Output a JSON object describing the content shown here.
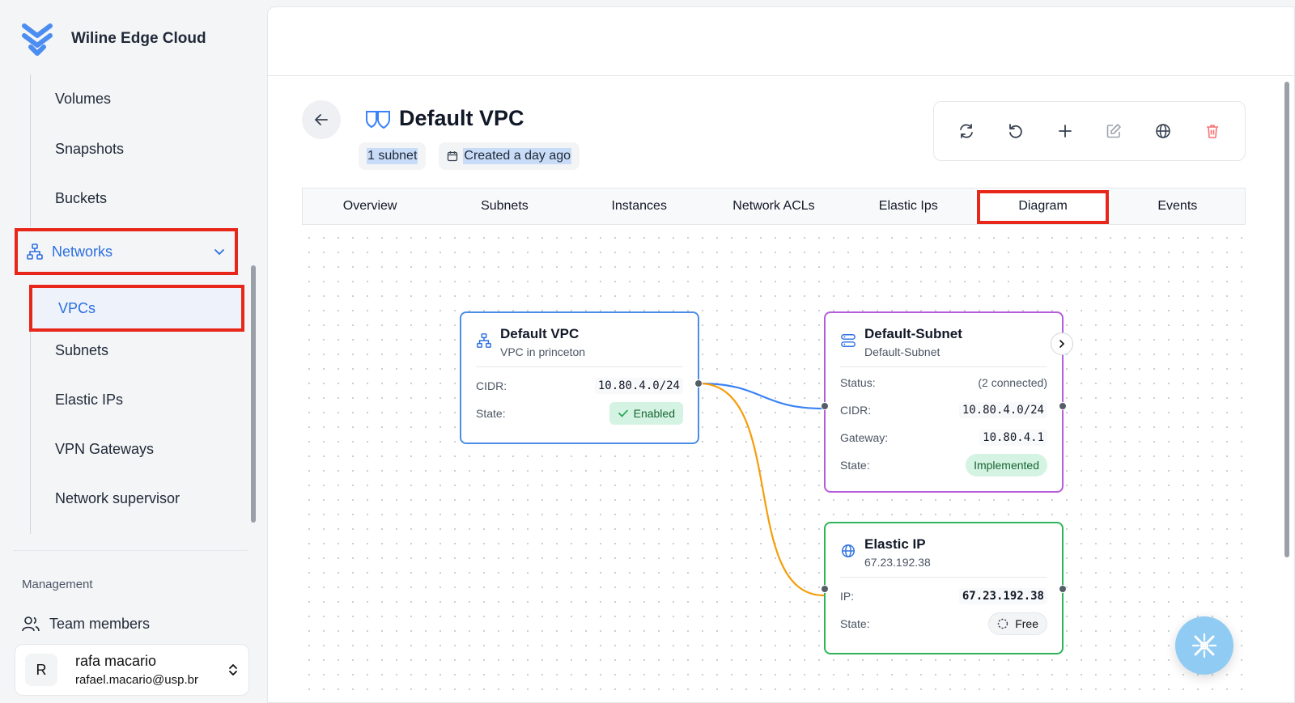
{
  "brand": {
    "name": "Wiline Edge Cloud"
  },
  "sidebar": {
    "items": [
      {
        "label": "Volumes"
      },
      {
        "label": "Snapshots"
      },
      {
        "label": "Buckets"
      },
      {
        "label": "Networks"
      },
      {
        "label": "VPCs"
      },
      {
        "label": "Subnets"
      },
      {
        "label": "Elastic IPs"
      },
      {
        "label": "VPN Gateways"
      },
      {
        "label": "Network supervisor"
      }
    ],
    "section_label": "Management",
    "team_label": "Team members"
  },
  "user": {
    "initial": "R",
    "name": "rafa macario",
    "email": "rafael.macario@usp.br"
  },
  "page": {
    "title": "Default VPC",
    "subnet_chip": "1 subnet",
    "created_chip": "Created a day ago"
  },
  "toolbar": [
    "refresh-icon",
    "undo-icon",
    "plus-icon",
    "edit-icon",
    "globe-icon",
    "trash-icon"
  ],
  "tabs": [
    "Overview",
    "Subnets",
    "Instances",
    "Network ACLs",
    "Elastic Ips",
    "Diagram",
    "Events"
  ],
  "active_tab": "Diagram",
  "diagram": {
    "vpc": {
      "title": "Default VPC",
      "subtitle": "VPC in princeton",
      "cidr_label": "CIDR:",
      "cidr": "10.80.4.0/24",
      "state_label": "State:",
      "state": "Enabled"
    },
    "subnet": {
      "title": "Default-Subnet",
      "subtitle": "Default-Subnet",
      "status_label": "Status:",
      "status": "(2 connected)",
      "cidr_label": "CIDR:",
      "cidr": "10.80.4.0/24",
      "gateway_label": "Gateway:",
      "gateway": "10.80.4.1",
      "state_label": "State:",
      "state": "Implemented"
    },
    "eip": {
      "title": "Elastic IP",
      "subtitle": "67.23.192.38",
      "ip_label": "IP:",
      "ip": "67.23.192.38",
      "state_label": "State:",
      "state": "Free"
    }
  },
  "colors": {
    "accent": "#2b6fe0",
    "highlight": "#e8261a",
    "vpc_border": "#4a8ee8",
    "subnet_border": "#b55ddc",
    "eip_border": "#2fb45a",
    "edge_subnet": "#3b82f6",
    "edge_eip": "#f59e0b"
  }
}
